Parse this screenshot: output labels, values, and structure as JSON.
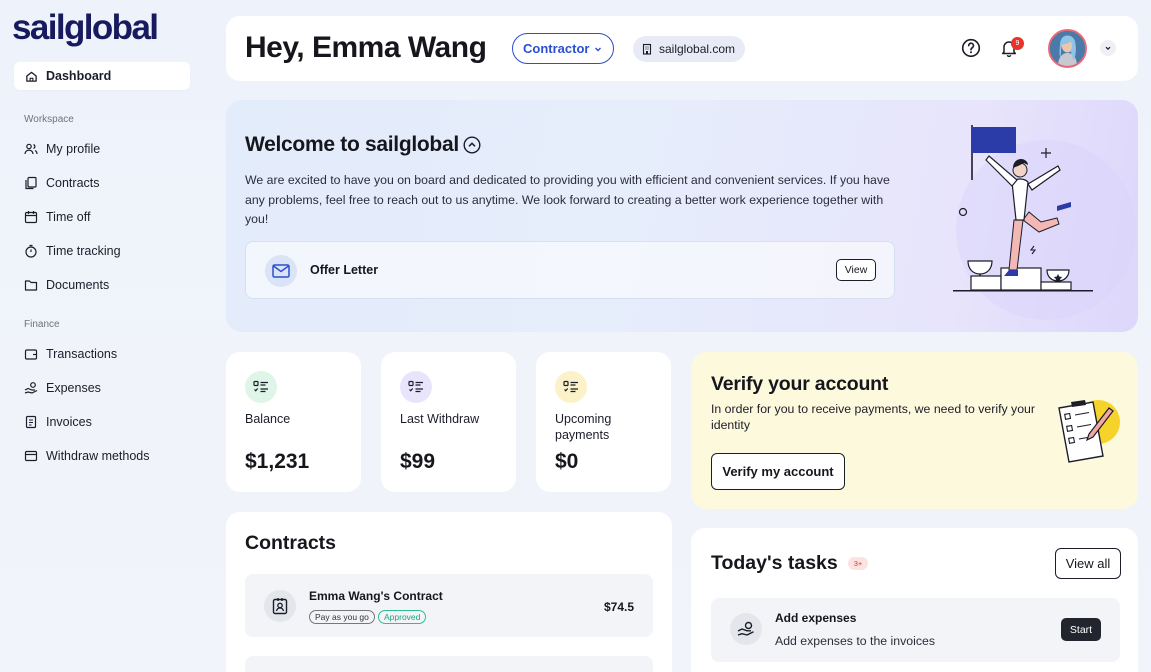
{
  "brand": {
    "logo": "sailglobal"
  },
  "sidebar": {
    "dashboard": "Dashboard",
    "workspace_label": "Workspace",
    "workspace_items": [
      "My profile",
      "Contracts",
      "Time off",
      "Time tracking",
      "Documents"
    ],
    "finance_label": "Finance",
    "finance_items": [
      "Transactions",
      "Expenses",
      "Invoices",
      "Withdraw methods"
    ]
  },
  "header": {
    "greeting": "Hey, Emma Wang",
    "role": "Contractor",
    "domain": "sailglobal.com",
    "notification_count": "9"
  },
  "welcome": {
    "title": "Welcome to sailglobal",
    "text": "We are excited to have you on board and dedicated to providing you with efficient and convenient services. If you have any problems, feel free to reach out to us anytime. We look forward to creating a better work experience together with you!",
    "offer_label": "Offer Letter",
    "view_label": "View"
  },
  "stats": [
    {
      "label": "Balance",
      "value": "$1,231",
      "color": "#dff5e8"
    },
    {
      "label": "Last Withdraw",
      "value": "$99",
      "color": "#e8e4fb"
    },
    {
      "label": "Upcoming payments",
      "value": "$0",
      "color": "#fbf2c9"
    }
  ],
  "verify": {
    "title": "Verify your account",
    "text": "In order for you to receive payments, we need to verify your identity",
    "button": "Verify my account"
  },
  "contracts": {
    "title": "Contracts",
    "items": [
      {
        "name": "Emma Wang's Contract",
        "tag1": "Pay as you go",
        "tag2": "Approved",
        "amount": "$74.5"
      }
    ]
  },
  "tasks": {
    "title": "Today's tasks",
    "count": "3+",
    "view_all": "View all",
    "items": [
      {
        "title": "Add expenses",
        "subtitle": "Add expenses to the invoices",
        "action": "Start"
      }
    ]
  },
  "colors": {
    "accent": "#2a4fd0",
    "brand": "#171a5e",
    "alert": "#e5342b",
    "approved": "#1aa57a"
  }
}
